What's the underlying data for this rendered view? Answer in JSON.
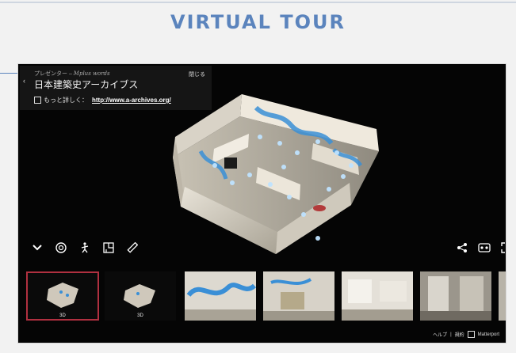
{
  "page": {
    "title": "VIRTUAL TOUR"
  },
  "info_panel": {
    "presenter_label": "プレゼンター",
    "presenter_name": "Mplus words",
    "org_name": "日本建築史アーカイブス",
    "more_label": "もっと詳しく：",
    "url": "http://www.a-archives.org/",
    "collapse_label": "閉じる"
  },
  "controls": {
    "left": [
      "dropdown-icon",
      "dollhouse-view-icon",
      "walk-icon",
      "floorplan-icon",
      "measure-icon"
    ],
    "right": [
      "share-icon",
      "vr-icon",
      "fullscreen-icon"
    ]
  },
  "thumbnails": [
    {
      "label": "3D",
      "kind": "dollhouse-3d"
    },
    {
      "label": "3D",
      "kind": "dollhouse-3d"
    },
    {
      "label": "",
      "kind": "room-photo"
    },
    {
      "label": "",
      "kind": "room-photo"
    },
    {
      "label": "",
      "kind": "room-photo"
    },
    {
      "label": "",
      "kind": "room-photo"
    },
    {
      "label": "",
      "kind": "room-photo"
    }
  ],
  "footer": {
    "help_label": "ヘルプ",
    "terms_label": "規約",
    "brand_label": "Matterport"
  },
  "colors": {
    "accent": "#5b84bd",
    "selected_outline": "#b03040",
    "viewer_bg": "#050505"
  }
}
